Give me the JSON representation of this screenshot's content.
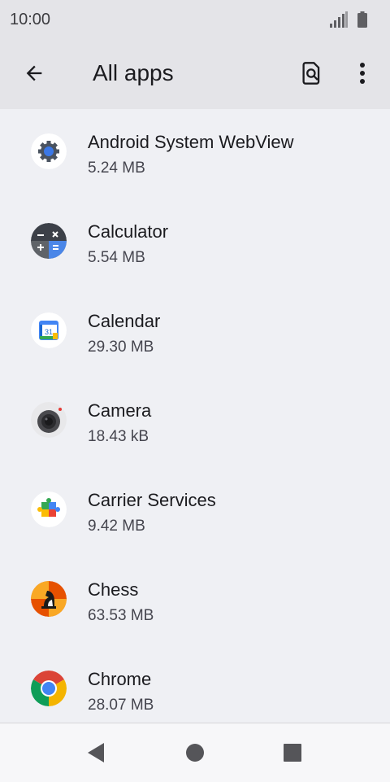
{
  "status_bar": {
    "time": "10:00"
  },
  "app_bar": {
    "title": "All apps"
  },
  "apps": [
    {
      "name": "Android System WebView",
      "size": "5.24 MB"
    },
    {
      "name": "Calculator",
      "size": "5.54 MB"
    },
    {
      "name": "Calendar",
      "size": "29.30 MB",
      "icon_text": "31"
    },
    {
      "name": "Camera",
      "size": "18.43 kB"
    },
    {
      "name": "Carrier Services",
      "size": "9.42 MB"
    },
    {
      "name": "Chess",
      "size": "63.53 MB"
    },
    {
      "name": "Chrome",
      "size": "28.07 MB"
    }
  ]
}
